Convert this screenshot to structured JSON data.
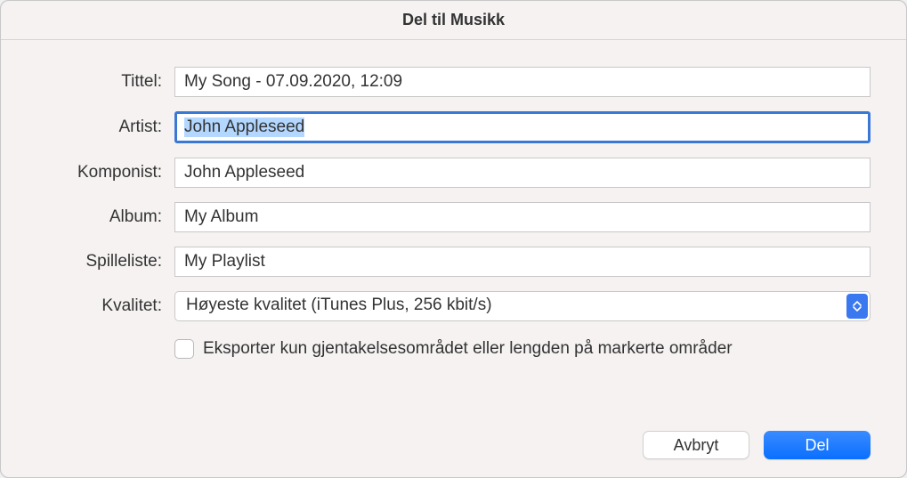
{
  "dialog": {
    "title": "Del til Musikk"
  },
  "form": {
    "title_label": "Tittel:",
    "title_value": "My Song - 07.09.2020, 12:09",
    "artist_label": "Artist:",
    "artist_value": "John Appleseed",
    "composer_label": "Komponist:",
    "composer_value": "John Appleseed",
    "album_label": "Album:",
    "album_value": "My Album",
    "playlist_label": "Spilleliste:",
    "playlist_value": "My Playlist",
    "quality_label": "Kvalitet:",
    "quality_value": "Høyeste kvalitet (iTunes Plus, 256 kbit/s)",
    "export_checkbox_label": "Eksporter kun gjentakelsesområdet eller lengden på markerte områder"
  },
  "buttons": {
    "cancel": "Avbryt",
    "share": "Del"
  }
}
